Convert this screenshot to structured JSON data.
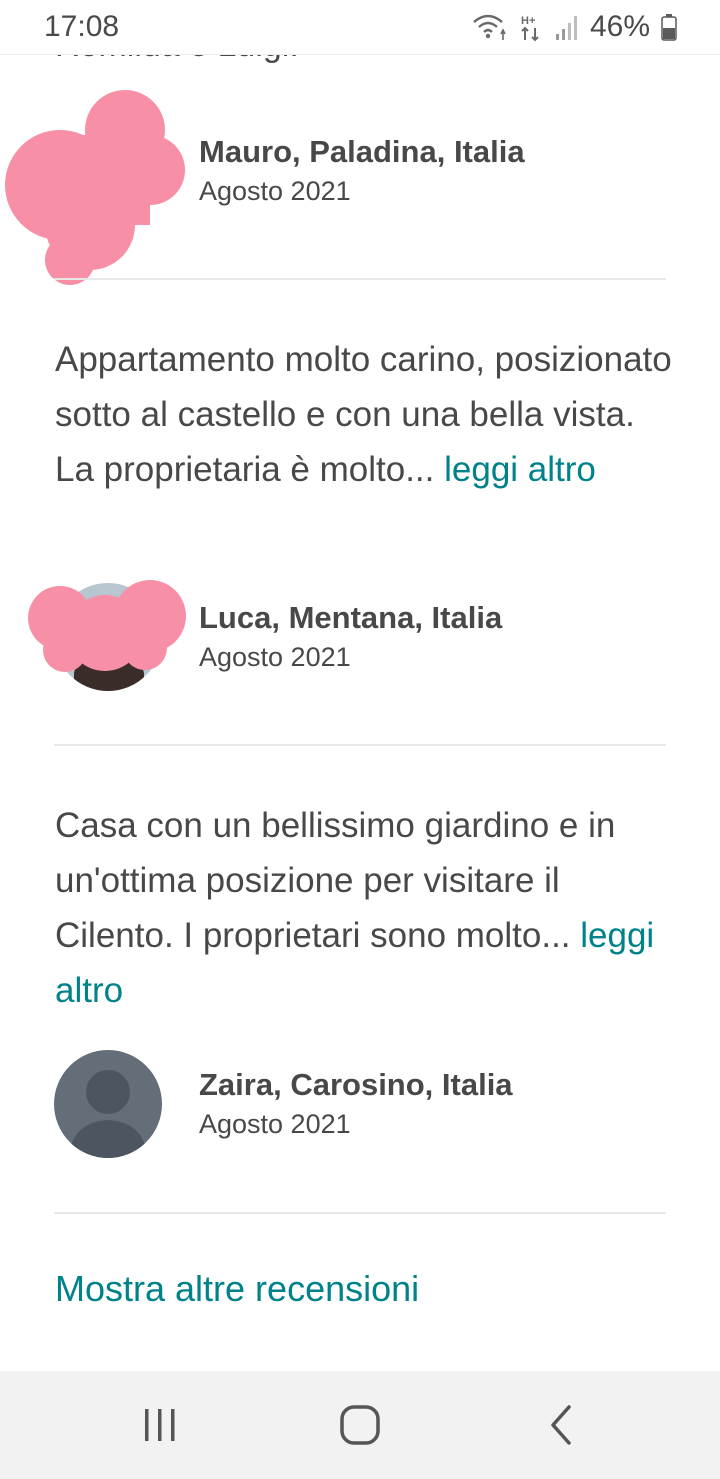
{
  "status_bar": {
    "time": "17:08",
    "battery": "46%"
  },
  "clipped_text": "Romilda e Luigi.",
  "reviews": [
    {
      "text": "",
      "more": "",
      "author": "Mauro, Paladina, Italia",
      "date": "Agosto 2021",
      "avatar": "redacted-pink"
    },
    {
      "text": "Appartamento molto carino, posizionato sotto al castello e con una bella vista. La proprietaria è molto...",
      "more": "leggi altro",
      "author": "Luca, Mentana, Italia",
      "date": "Agosto 2021",
      "avatar": "redacted-pink"
    },
    {
      "text": "Casa con un bellissimo giardino e in un'ottima posizione per visitare il Cilento. I proprietari sono molto...",
      "more": "leggi altro",
      "author": "Zaira, Carosino, Italia",
      "date": "Agosto 2021",
      "avatar": "default-user-icon"
    }
  ],
  "show_more": "Mostra altre recensioni",
  "colors": {
    "link": "#00828a",
    "text": "#484848",
    "redaction": "#f78fa7",
    "avatar_bg": "#646e79"
  },
  "icons": [
    "wifi-icon",
    "data-transfer-icon",
    "signal-icon",
    "battery-icon",
    "recent-apps-icon",
    "home-icon",
    "back-icon",
    "user-icon"
  ]
}
